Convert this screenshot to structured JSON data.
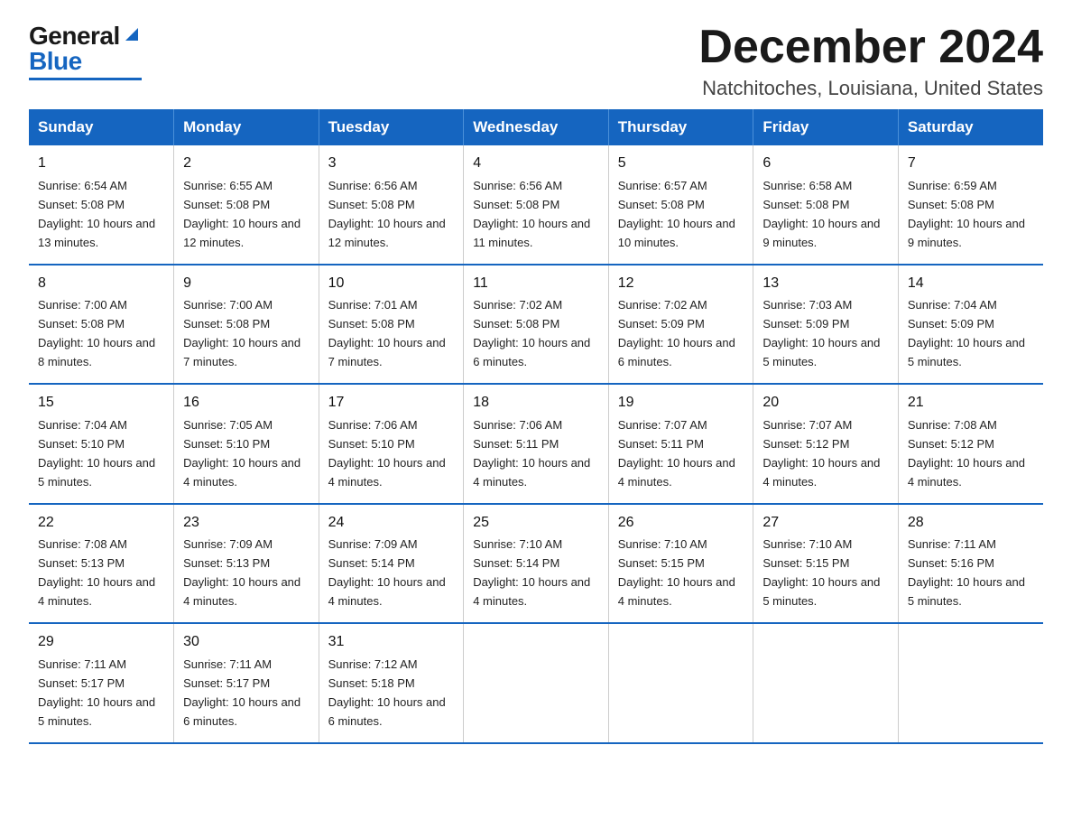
{
  "header": {
    "logo_general": "General",
    "logo_blue": "Blue",
    "month_title": "December 2024",
    "location": "Natchitoches, Louisiana, United States"
  },
  "days_of_week": [
    "Sunday",
    "Monday",
    "Tuesday",
    "Wednesday",
    "Thursday",
    "Friday",
    "Saturday"
  ],
  "weeks": [
    [
      {
        "day": "1",
        "sunrise": "6:54 AM",
        "sunset": "5:08 PM",
        "daylight": "10 hours and 13 minutes."
      },
      {
        "day": "2",
        "sunrise": "6:55 AM",
        "sunset": "5:08 PM",
        "daylight": "10 hours and 12 minutes."
      },
      {
        "day": "3",
        "sunrise": "6:56 AM",
        "sunset": "5:08 PM",
        "daylight": "10 hours and 12 minutes."
      },
      {
        "day": "4",
        "sunrise": "6:56 AM",
        "sunset": "5:08 PM",
        "daylight": "10 hours and 11 minutes."
      },
      {
        "day": "5",
        "sunrise": "6:57 AM",
        "sunset": "5:08 PM",
        "daylight": "10 hours and 10 minutes."
      },
      {
        "day": "6",
        "sunrise": "6:58 AM",
        "sunset": "5:08 PM",
        "daylight": "10 hours and 9 minutes."
      },
      {
        "day": "7",
        "sunrise": "6:59 AM",
        "sunset": "5:08 PM",
        "daylight": "10 hours and 9 minutes."
      }
    ],
    [
      {
        "day": "8",
        "sunrise": "7:00 AM",
        "sunset": "5:08 PM",
        "daylight": "10 hours and 8 minutes."
      },
      {
        "day": "9",
        "sunrise": "7:00 AM",
        "sunset": "5:08 PM",
        "daylight": "10 hours and 7 minutes."
      },
      {
        "day": "10",
        "sunrise": "7:01 AM",
        "sunset": "5:08 PM",
        "daylight": "10 hours and 7 minutes."
      },
      {
        "day": "11",
        "sunrise": "7:02 AM",
        "sunset": "5:08 PM",
        "daylight": "10 hours and 6 minutes."
      },
      {
        "day": "12",
        "sunrise": "7:02 AM",
        "sunset": "5:09 PM",
        "daylight": "10 hours and 6 minutes."
      },
      {
        "day": "13",
        "sunrise": "7:03 AM",
        "sunset": "5:09 PM",
        "daylight": "10 hours and 5 minutes."
      },
      {
        "day": "14",
        "sunrise": "7:04 AM",
        "sunset": "5:09 PM",
        "daylight": "10 hours and 5 minutes."
      }
    ],
    [
      {
        "day": "15",
        "sunrise": "7:04 AM",
        "sunset": "5:10 PM",
        "daylight": "10 hours and 5 minutes."
      },
      {
        "day": "16",
        "sunrise": "7:05 AM",
        "sunset": "5:10 PM",
        "daylight": "10 hours and 4 minutes."
      },
      {
        "day": "17",
        "sunrise": "7:06 AM",
        "sunset": "5:10 PM",
        "daylight": "10 hours and 4 minutes."
      },
      {
        "day": "18",
        "sunrise": "7:06 AM",
        "sunset": "5:11 PM",
        "daylight": "10 hours and 4 minutes."
      },
      {
        "day": "19",
        "sunrise": "7:07 AM",
        "sunset": "5:11 PM",
        "daylight": "10 hours and 4 minutes."
      },
      {
        "day": "20",
        "sunrise": "7:07 AM",
        "sunset": "5:12 PM",
        "daylight": "10 hours and 4 minutes."
      },
      {
        "day": "21",
        "sunrise": "7:08 AM",
        "sunset": "5:12 PM",
        "daylight": "10 hours and 4 minutes."
      }
    ],
    [
      {
        "day": "22",
        "sunrise": "7:08 AM",
        "sunset": "5:13 PM",
        "daylight": "10 hours and 4 minutes."
      },
      {
        "day": "23",
        "sunrise": "7:09 AM",
        "sunset": "5:13 PM",
        "daylight": "10 hours and 4 minutes."
      },
      {
        "day": "24",
        "sunrise": "7:09 AM",
        "sunset": "5:14 PM",
        "daylight": "10 hours and 4 minutes."
      },
      {
        "day": "25",
        "sunrise": "7:10 AM",
        "sunset": "5:14 PM",
        "daylight": "10 hours and 4 minutes."
      },
      {
        "day": "26",
        "sunrise": "7:10 AM",
        "sunset": "5:15 PM",
        "daylight": "10 hours and 4 minutes."
      },
      {
        "day": "27",
        "sunrise": "7:10 AM",
        "sunset": "5:15 PM",
        "daylight": "10 hours and 5 minutes."
      },
      {
        "day": "28",
        "sunrise": "7:11 AM",
        "sunset": "5:16 PM",
        "daylight": "10 hours and 5 minutes."
      }
    ],
    [
      {
        "day": "29",
        "sunrise": "7:11 AM",
        "sunset": "5:17 PM",
        "daylight": "10 hours and 5 minutes."
      },
      {
        "day": "30",
        "sunrise": "7:11 AM",
        "sunset": "5:17 PM",
        "daylight": "10 hours and 6 minutes."
      },
      {
        "day": "31",
        "sunrise": "7:12 AM",
        "sunset": "5:18 PM",
        "daylight": "10 hours and 6 minutes."
      },
      null,
      null,
      null,
      null
    ]
  ]
}
